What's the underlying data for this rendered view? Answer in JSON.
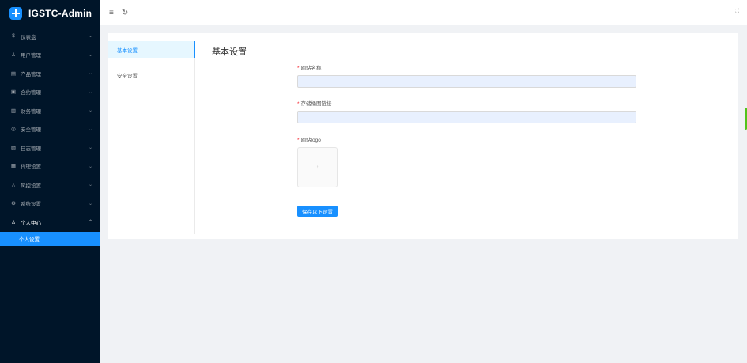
{
  "app": {
    "title": "IGSTC-Admin"
  },
  "sidebar": {
    "items": [
      {
        "icon": "$",
        "label": "仪表盘",
        "arrow": "⌄"
      },
      {
        "icon": "♙",
        "label": "用户管理",
        "arrow": "⌄"
      },
      {
        "icon": "▤",
        "label": "产品管理",
        "arrow": "⌄"
      },
      {
        "icon": "▣",
        "label": "合约管理",
        "arrow": "⌄"
      },
      {
        "icon": "▥",
        "label": "财务管理",
        "arrow": "⌄"
      },
      {
        "icon": "◎",
        "label": "安全管理",
        "arrow": "⌄"
      },
      {
        "icon": "▧",
        "label": "日志管理",
        "arrow": "⌄"
      },
      {
        "icon": "▦",
        "label": "代理设置",
        "arrow": "⌄"
      },
      {
        "icon": "△",
        "label": "风控设置",
        "arrow": "⌄"
      },
      {
        "icon": "⚙",
        "label": "系统设置",
        "arrow": "⌄"
      },
      {
        "icon": "♙",
        "label": "个人中心",
        "arrow": "⌃"
      }
    ],
    "submenu": {
      "label": "个人设置"
    }
  },
  "header": {
    "menu_icon": "≡",
    "refresh_icon": "↻",
    "fullscreen_icon": "⛶"
  },
  "tabs": [
    {
      "label": "基本设置"
    },
    {
      "label": "安全设置"
    }
  ],
  "panel": {
    "title": "基本设置",
    "fields": [
      {
        "label": "网站名称",
        "value": ""
      },
      {
        "label": "存储桶图链接",
        "value": ""
      },
      {
        "label": "网站logo"
      }
    ],
    "upload_glyph": "↑",
    "save_label": "保存以下设置"
  },
  "colors": {
    "sidebar": "#001529",
    "accent": "#1890ff",
    "required": "#f5222d",
    "input_fill": "#e8f0fe"
  }
}
